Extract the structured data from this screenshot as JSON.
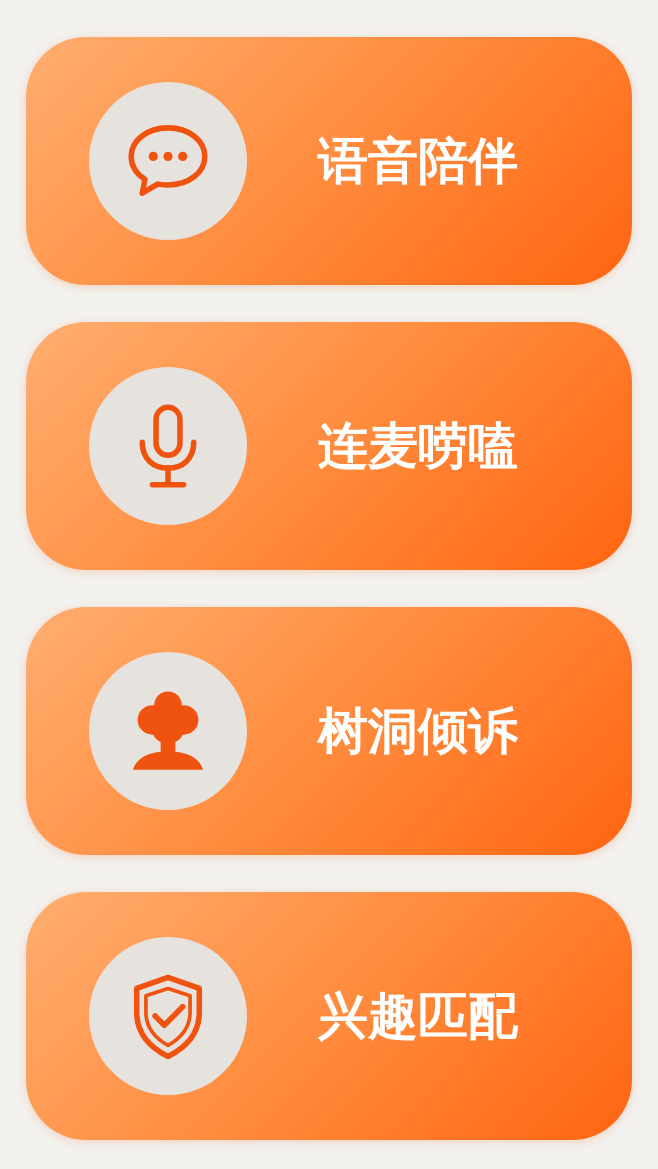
{
  "items": [
    {
      "label": "语音陪伴",
      "kind": "chat"
    },
    {
      "label": "连麦唠嗑",
      "kind": "mic"
    },
    {
      "label": "树洞倾诉",
      "kind": "tree"
    },
    {
      "label": "兴趣匹配",
      "kind": "shield"
    }
  ]
}
